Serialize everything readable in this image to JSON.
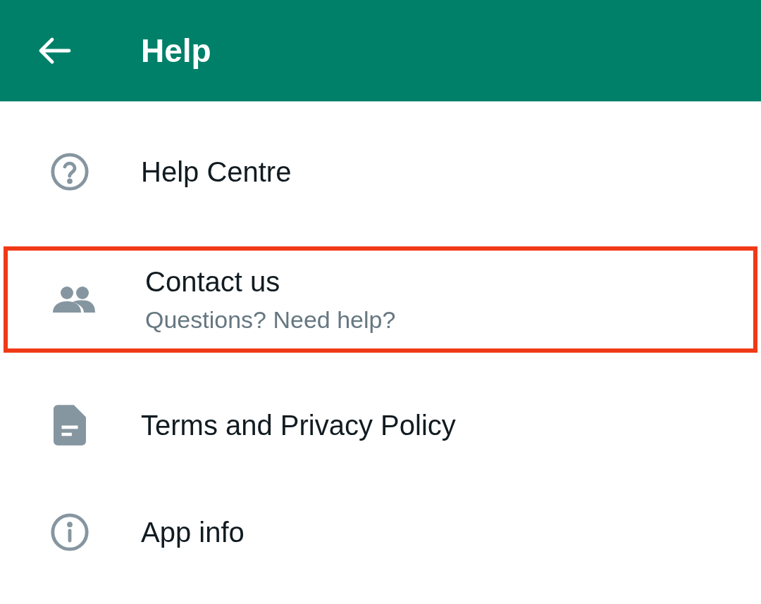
{
  "header": {
    "title": "Help"
  },
  "items": [
    {
      "kind": "help",
      "label": "Help Centre",
      "highlighted": false
    },
    {
      "kind": "people",
      "label": "Contact us",
      "subtitle": "Questions? Need help?",
      "highlighted": true
    },
    {
      "kind": "document",
      "label": "Terms and Privacy Policy",
      "highlighted": false
    },
    {
      "kind": "info",
      "label": "App info",
      "highlighted": false
    }
  ]
}
